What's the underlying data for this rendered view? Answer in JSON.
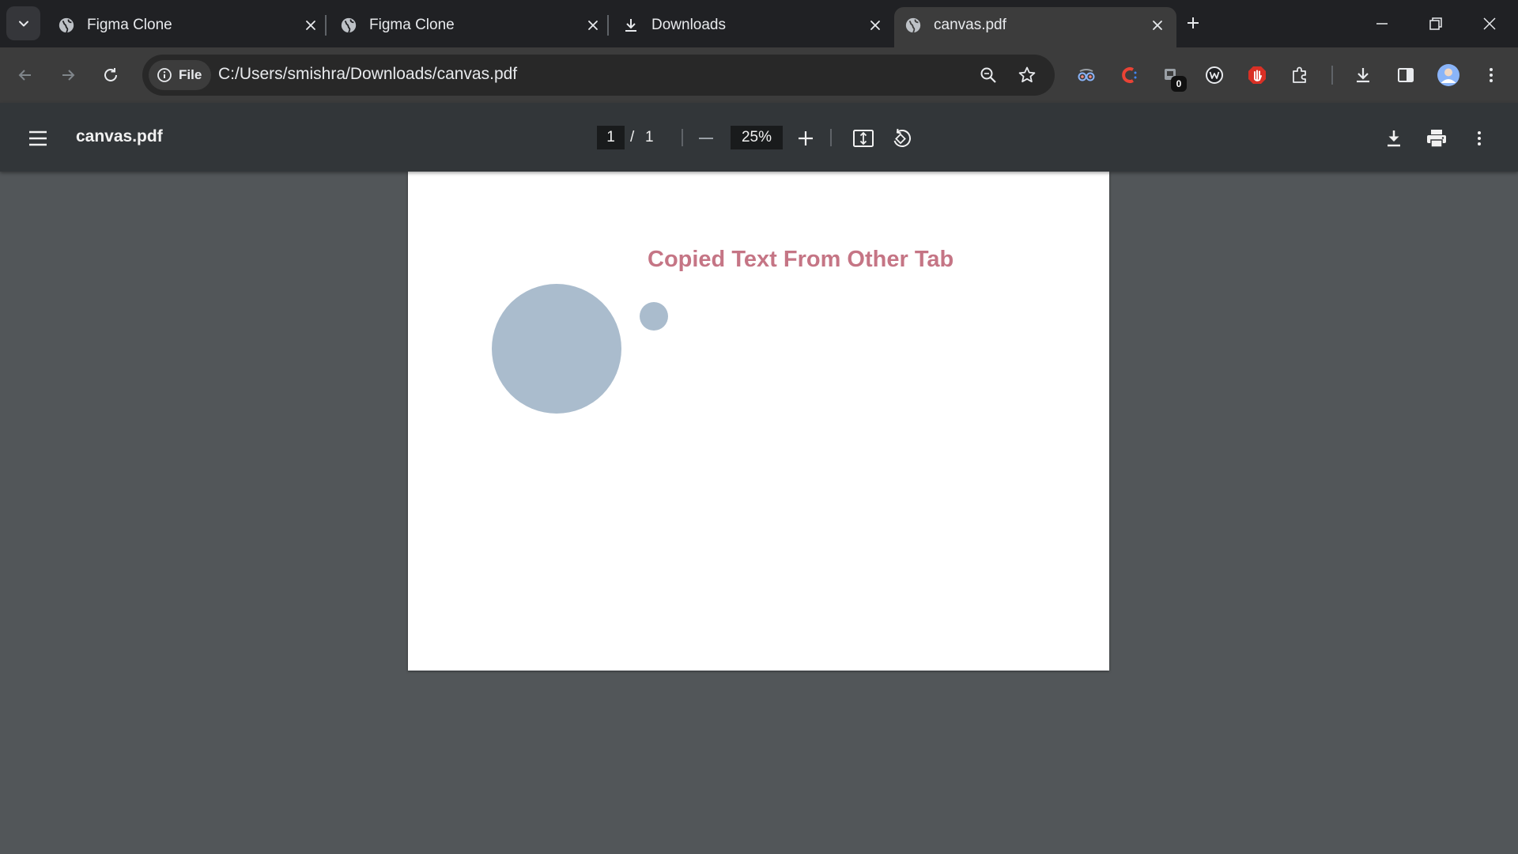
{
  "tabs": [
    {
      "title": "Figma Clone",
      "icon": "globe-icon",
      "active": false
    },
    {
      "title": "Figma Clone",
      "icon": "globe-icon",
      "active": false
    },
    {
      "title": "Downloads",
      "icon": "download-icon",
      "active": false
    },
    {
      "title": "canvas.pdf",
      "icon": "globe-icon",
      "active": true
    }
  ],
  "omnibox": {
    "chip_label": "File",
    "url": "C:/Users/smishra/Downloads/canvas.pdf"
  },
  "extensions": {
    "badge_count": "0"
  },
  "pdf": {
    "title": "canvas.pdf",
    "current_page": "1",
    "page_separator": "/",
    "total_pages": "1",
    "zoom": "25%"
  },
  "document": {
    "text": "Copied Text From Other Tab",
    "text_color": "#c57585",
    "shape_color": "#aabccd"
  },
  "colors": {
    "tabstrip": "#202124",
    "toolbar": "#3c3c3c",
    "pdf_header": "#323639",
    "viewer_bg": "#525659"
  }
}
